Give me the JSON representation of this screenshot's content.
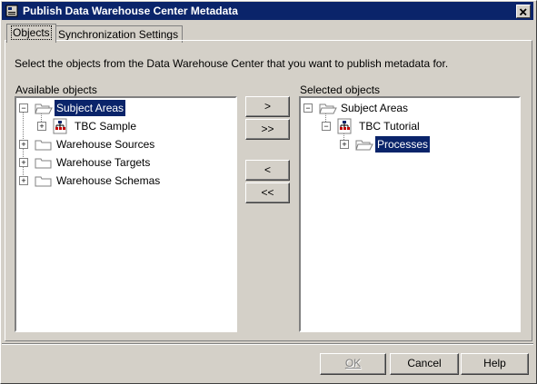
{
  "window": {
    "title": "Publish Data Warehouse Center Metadata",
    "close_glyph": "✕"
  },
  "tabs": [
    {
      "label": "Objects",
      "active": true
    },
    {
      "label": "Synchronization Settings",
      "active": false
    }
  ],
  "instructions": "Select the objects from the Data Warehouse Center that you want to publish metadata for.",
  "available": {
    "label": "Available objects",
    "items": [
      {
        "label": "Subject Areas",
        "icon": "folder-open-icon",
        "expander": "−",
        "selected": true
      },
      {
        "label": "TBC Sample",
        "icon": "subject-area-icon",
        "expander": "+",
        "selected": false
      },
      {
        "label": "Warehouse Sources",
        "icon": "folder-icon",
        "expander": "+",
        "selected": false
      },
      {
        "label": "Warehouse Targets",
        "icon": "folder-icon",
        "expander": "+",
        "selected": false
      },
      {
        "label": "Warehouse Schemas",
        "icon": "folder-icon",
        "expander": "+",
        "selected": false
      }
    ]
  },
  "selected": {
    "label": "Selected objects",
    "items": [
      {
        "label": "Subject Areas",
        "icon": "folder-open-icon",
        "expander": "−",
        "selected": false
      },
      {
        "label": "TBC Tutorial",
        "icon": "subject-area-icon",
        "expander": "−",
        "selected": false
      },
      {
        "label": "Processes",
        "icon": "folder-open-icon",
        "expander": "+",
        "selected": true
      }
    ]
  },
  "transfer": {
    "add": ">",
    "add_all": ">>",
    "remove": "<",
    "remove_all": "<<"
  },
  "footer": {
    "ok": "OK",
    "cancel": "Cancel",
    "help": "Help"
  },
  "colors": {
    "selection": "#0a246a",
    "face": "#d4d0c8",
    "title_bar": "#0a246a"
  }
}
